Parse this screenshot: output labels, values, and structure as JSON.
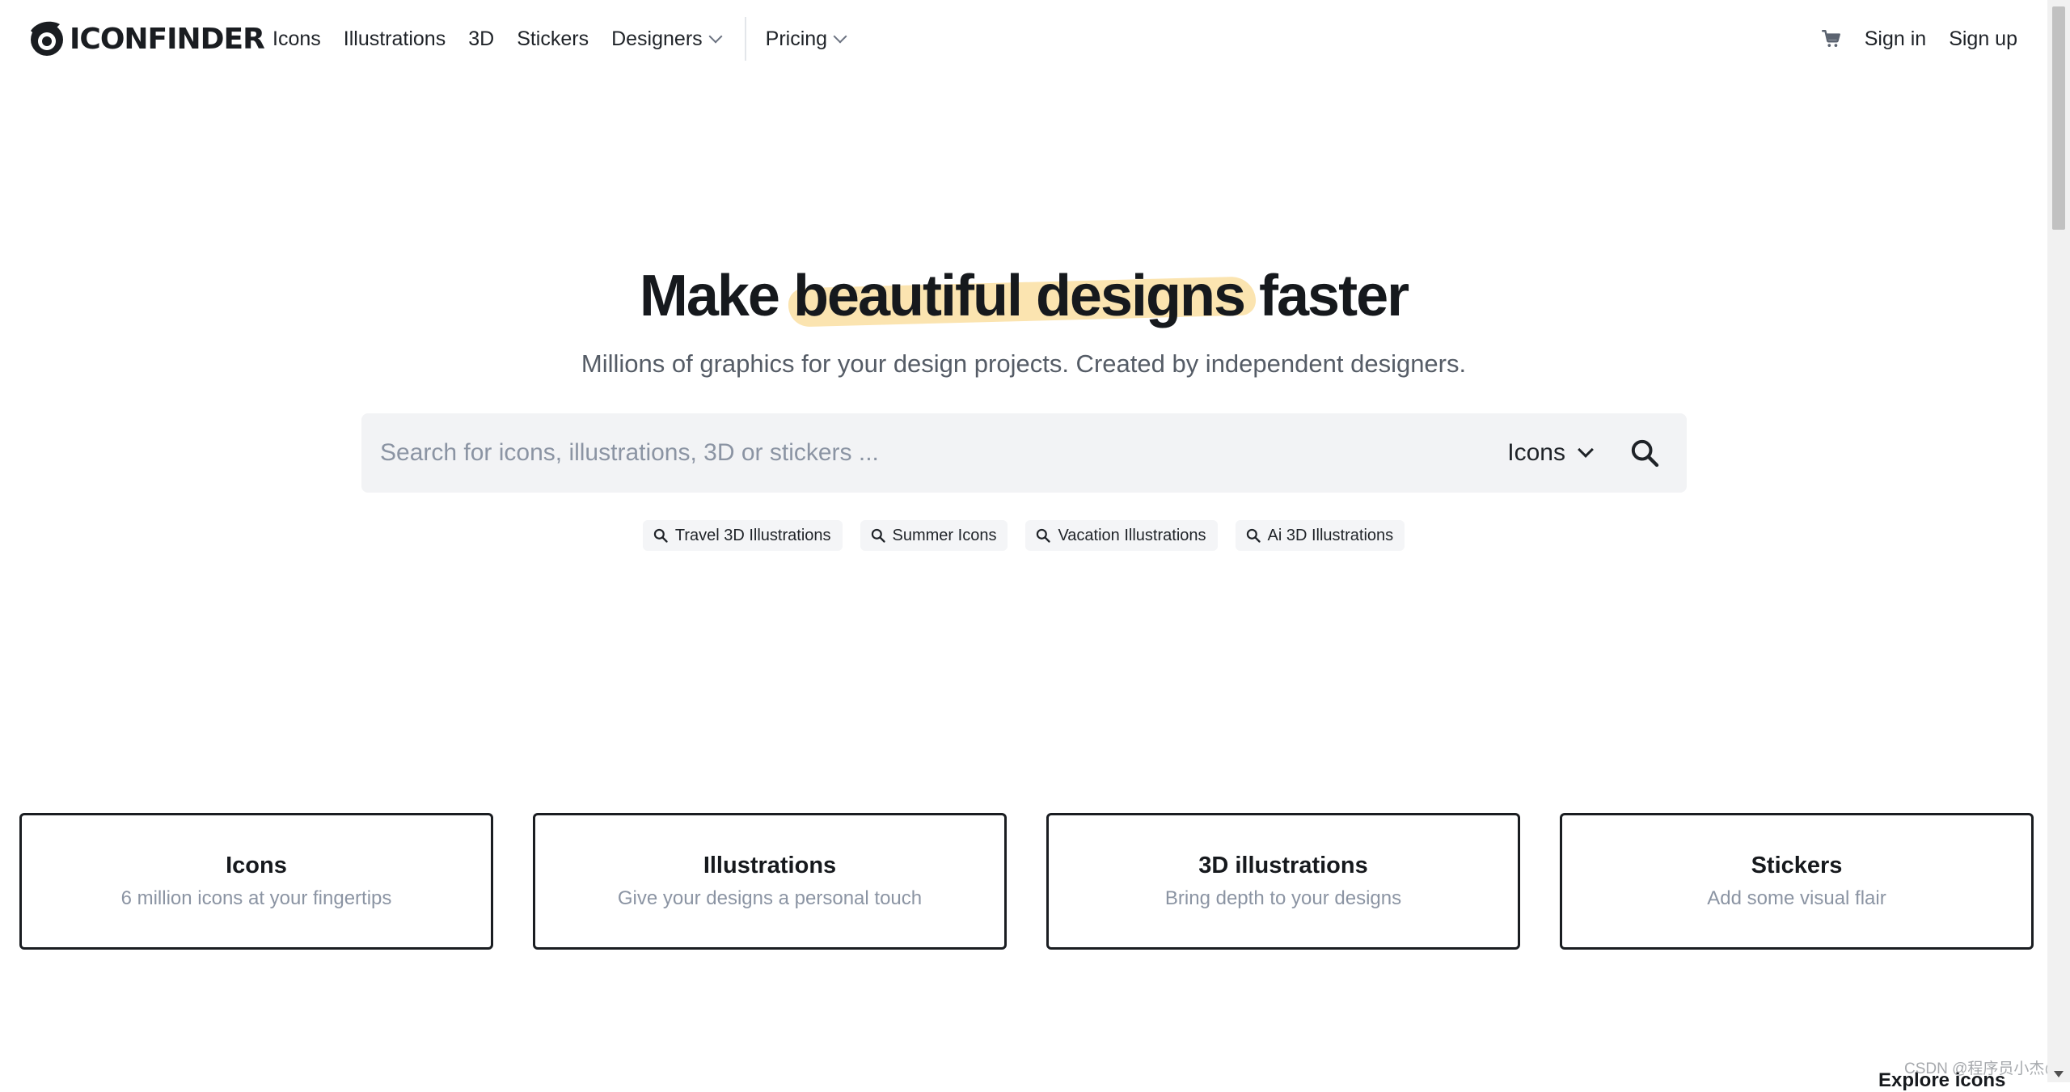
{
  "header": {
    "logo_text": "ICONFINDER",
    "nav": [
      {
        "label": "Icons"
      },
      {
        "label": "Illustrations"
      },
      {
        "label": "3D"
      },
      {
        "label": "Stickers"
      },
      {
        "label": "Designers",
        "dropdown": true
      },
      {
        "label": "Pricing",
        "dropdown": true
      }
    ],
    "sign_in": "Sign in",
    "sign_up": "Sign up",
    "cart_icon": "cart-icon"
  },
  "hero": {
    "title_before": "Make ",
    "title_highlight": "beautiful designs",
    "title_after": " faster",
    "subtitle": "Millions of graphics for your design projects. Created by independent designers.",
    "highlight_color": "#fbe4b0"
  },
  "search": {
    "placeholder": "Search for icons, illustrations, 3D or stickers ...",
    "value": "",
    "type_selected": "Icons",
    "suggestions": [
      "Travel 3D Illustrations",
      "Summer Icons",
      "Vacation Illustrations",
      "Ai 3D Illustrations"
    ]
  },
  "categories": [
    {
      "title": "Icons",
      "description": "6 million icons at your fingertips"
    },
    {
      "title": "Illustrations",
      "description": "Give your designs a personal touch"
    },
    {
      "title": "3D illustrations",
      "description": "Bring depth to your designs"
    },
    {
      "title": "Stickers",
      "description": "Add some visual flair"
    }
  ],
  "footer_peek": {
    "explore_label": "Explore icons",
    "watermark": "CSDN @程序员小杰@"
  },
  "colors": {
    "text_primary": "#16191d",
    "text_muted": "#8b94a3",
    "search_bg": "#f2f3f5",
    "card_border": "#1a1d21"
  }
}
